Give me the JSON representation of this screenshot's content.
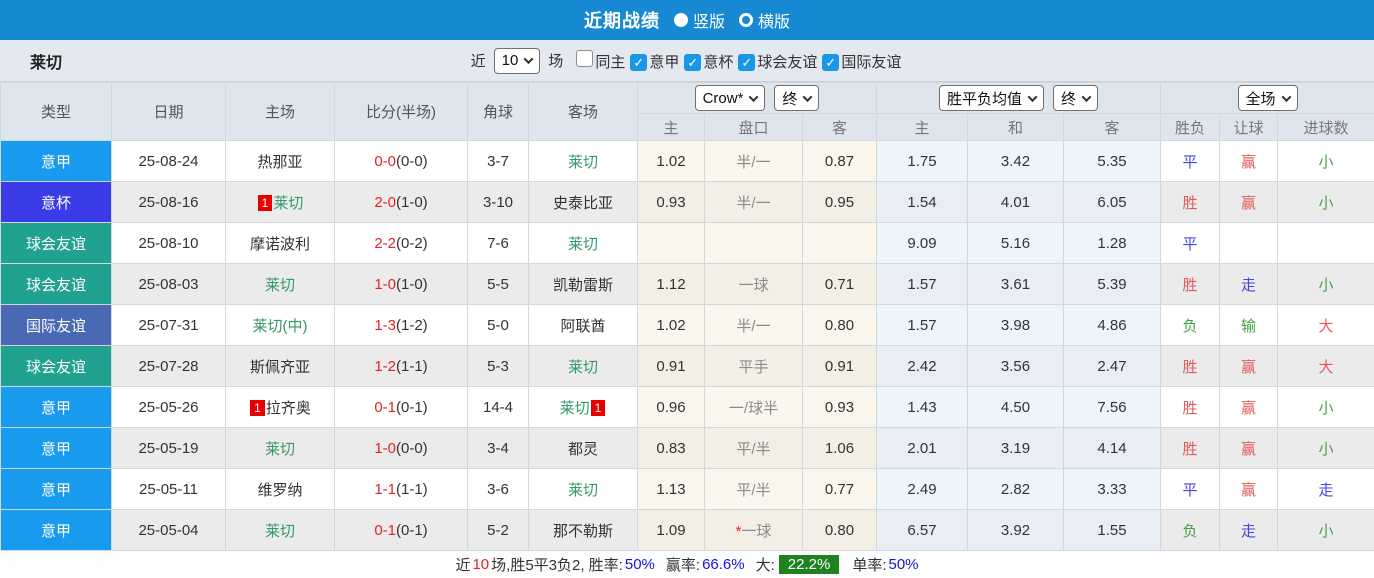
{
  "title_bar": {
    "title": "近期战绩",
    "radio_vertical": "竖版",
    "radio_horizontal": "横版"
  },
  "filter": {
    "team": "莱切",
    "near_label": "近",
    "count_value": "10",
    "games_label": "场",
    "checks": [
      {
        "label": "同主",
        "checked": false
      },
      {
        "label": "意甲",
        "checked": true
      },
      {
        "label": "意杯",
        "checked": true
      },
      {
        "label": "球会友谊",
        "checked": true
      },
      {
        "label": "国际友谊",
        "checked": true
      }
    ]
  },
  "table": {
    "headers": {
      "type": "类型",
      "date": "日期",
      "home": "主场",
      "score": "比分(半场)",
      "corner": "角球",
      "away": "客场",
      "ah_home": "主",
      "ah_line": "盘口",
      "ah_away": "客",
      "eu_home": "主",
      "eu_draw": "和",
      "eu_away": "客",
      "result": "胜负",
      "handicap_result": "让球",
      "goals": "进球数"
    },
    "dropdowns": {
      "company": "Crow*",
      "company_final": "终",
      "avg": "胜平负均值",
      "avg_final": "终",
      "scope": "全场"
    },
    "rows": [
      {
        "type": "意甲",
        "date": "25-08-24",
        "home": {
          "pre": "",
          "name": "热那亚",
          "green": false,
          "post": ""
        },
        "score": "0-0",
        "half": "(0-0)",
        "corner": "3-7",
        "away": {
          "pre": "",
          "name": "莱切",
          "green": true,
          "post": ""
        },
        "ah": {
          "home": "1.02",
          "prefix": "",
          "line": "半/一",
          "away": "0.87"
        },
        "eu": [
          "1.75",
          "3.42",
          "5.35"
        ],
        "result": {
          "t": "平",
          "c": "blue"
        },
        "handicap_result": {
          "t": "赢",
          "c": "red"
        },
        "goals": {
          "t": "小",
          "c": "green"
        }
      },
      {
        "type": "意杯",
        "date": "25-08-16",
        "home": {
          "pre": "1",
          "name": "莱切",
          "green": true,
          "post": ""
        },
        "score": "2-0",
        "half": "(1-0)",
        "corner": "3-10",
        "away": {
          "pre": "",
          "name": "史泰比亚",
          "green": false,
          "post": ""
        },
        "ah": {
          "home": "0.93",
          "prefix": "",
          "line": "半/一",
          "away": "0.95"
        },
        "eu": [
          "1.54",
          "4.01",
          "6.05"
        ],
        "result": {
          "t": "胜",
          "c": "red"
        },
        "handicap_result": {
          "t": "赢",
          "c": "red"
        },
        "goals": {
          "t": "小",
          "c": "green"
        }
      },
      {
        "type": "球会友谊",
        "date": "25-08-10",
        "home": {
          "pre": "",
          "name": "摩诺波利",
          "green": false,
          "post": ""
        },
        "score": "2-2",
        "half": "(0-2)",
        "corner": "7-6",
        "away": {
          "pre": "",
          "name": "莱切",
          "green": true,
          "post": ""
        },
        "ah": {
          "home": "",
          "prefix": "",
          "line": "",
          "away": ""
        },
        "eu": [
          "9.09",
          "5.16",
          "1.28"
        ],
        "result": {
          "t": "平",
          "c": "blue"
        },
        "handicap_result": {
          "t": "",
          "c": ""
        },
        "goals": {
          "t": "",
          "c": ""
        }
      },
      {
        "type": "球会友谊",
        "date": "25-08-03",
        "home": {
          "pre": "",
          "name": "莱切",
          "green": true,
          "post": ""
        },
        "score": "1-0",
        "half": "(1-0)",
        "corner": "5-5",
        "away": {
          "pre": "",
          "name": "凯勒雷斯",
          "green": false,
          "post": ""
        },
        "ah": {
          "home": "1.12",
          "prefix": "",
          "line": "一球",
          "away": "0.71"
        },
        "eu": [
          "1.57",
          "3.61",
          "5.39"
        ],
        "result": {
          "t": "胜",
          "c": "red"
        },
        "handicap_result": {
          "t": "走",
          "c": "blue"
        },
        "goals": {
          "t": "小",
          "c": "green"
        }
      },
      {
        "type": "国际友谊",
        "date": "25-07-31",
        "home": {
          "pre": "",
          "name": "莱切(中)",
          "green": true,
          "post": ""
        },
        "score": "1-3",
        "half": "(1-2)",
        "corner": "5-0",
        "away": {
          "pre": "",
          "name": "阿联酋",
          "green": false,
          "post": ""
        },
        "ah": {
          "home": "1.02",
          "prefix": "",
          "line": "半/一",
          "away": "0.80"
        },
        "eu": [
          "1.57",
          "3.98",
          "4.86"
        ],
        "result": {
          "t": "负",
          "c": "green"
        },
        "handicap_result": {
          "t": "输",
          "c": "green"
        },
        "goals": {
          "t": "大",
          "c": "red"
        }
      },
      {
        "type": "球会友谊",
        "date": "25-07-28",
        "home": {
          "pre": "",
          "name": "斯佩齐亚",
          "green": false,
          "post": ""
        },
        "score": "1-2",
        "half": "(1-1)",
        "corner": "5-3",
        "away": {
          "pre": "",
          "name": "莱切",
          "green": true,
          "post": ""
        },
        "ah": {
          "home": "0.91",
          "prefix": "",
          "line": "平手",
          "away": "0.91"
        },
        "eu": [
          "2.42",
          "3.56",
          "2.47"
        ],
        "result": {
          "t": "胜",
          "c": "red"
        },
        "handicap_result": {
          "t": "赢",
          "c": "red"
        },
        "goals": {
          "t": "大",
          "c": "red"
        }
      },
      {
        "type": "意甲",
        "date": "25-05-26",
        "home": {
          "pre": "1",
          "name": "拉齐奥",
          "green": false,
          "post": ""
        },
        "score": "0-1",
        "half": "(0-1)",
        "corner": "14-4",
        "away": {
          "pre": "",
          "name": "莱切",
          "green": true,
          "post": "1"
        },
        "ah": {
          "home": "0.96",
          "prefix": "",
          "line": "一/球半",
          "away": "0.93"
        },
        "eu": [
          "1.43",
          "4.50",
          "7.56"
        ],
        "result": {
          "t": "胜",
          "c": "red"
        },
        "handicap_result": {
          "t": "赢",
          "c": "red"
        },
        "goals": {
          "t": "小",
          "c": "green"
        }
      },
      {
        "type": "意甲",
        "date": "25-05-19",
        "home": {
          "pre": "",
          "name": "莱切",
          "green": true,
          "post": ""
        },
        "score": "1-0",
        "half": "(0-0)",
        "corner": "3-4",
        "away": {
          "pre": "",
          "name": "都灵",
          "green": false,
          "post": ""
        },
        "ah": {
          "home": "0.83",
          "prefix": "",
          "line": "平/半",
          "away": "1.06"
        },
        "eu": [
          "2.01",
          "3.19",
          "4.14"
        ],
        "result": {
          "t": "胜",
          "c": "red"
        },
        "handicap_result": {
          "t": "赢",
          "c": "red"
        },
        "goals": {
          "t": "小",
          "c": "green"
        }
      },
      {
        "type": "意甲",
        "date": "25-05-11",
        "home": {
          "pre": "",
          "name": "维罗纳",
          "green": false,
          "post": ""
        },
        "score": "1-1",
        "half": "(1-1)",
        "corner": "3-6",
        "away": {
          "pre": "",
          "name": "莱切",
          "green": true,
          "post": ""
        },
        "ah": {
          "home": "1.13",
          "prefix": "",
          "line": "平/半",
          "away": "0.77"
        },
        "eu": [
          "2.49",
          "2.82",
          "3.33"
        ],
        "result": {
          "t": "平",
          "c": "blue"
        },
        "handicap_result": {
          "t": "赢",
          "c": "red"
        },
        "goals": {
          "t": "走",
          "c": "blue"
        }
      },
      {
        "type": "意甲",
        "date": "25-05-04",
        "home": {
          "pre": "",
          "name": "莱切",
          "green": true,
          "post": ""
        },
        "score": "0-1",
        "half": "(0-1)",
        "corner": "5-2",
        "away": {
          "pre": "",
          "name": "那不勒斯",
          "green": false,
          "post": ""
        },
        "ah": {
          "home": "1.09",
          "prefix": "*",
          "line": "一球",
          "away": "0.80"
        },
        "eu": [
          "6.57",
          "3.92",
          "1.55"
        ],
        "result": {
          "t": "负",
          "c": "green"
        },
        "handicap_result": {
          "t": "走",
          "c": "blue"
        },
        "goals": {
          "t": "小",
          "c": "green"
        }
      }
    ]
  },
  "summary": {
    "near_label": "近",
    "count": "10",
    "record": "场,胜5平3负2, 胜率:",
    "win_rate": "50%",
    "handicap_label": "赢率:",
    "handicap_rate": "66.6%",
    "big_label": "大:",
    "big_rate": "22.2%",
    "single_label": "单率:",
    "single_rate": "50%"
  },
  "palette": {
    "topbar_blue": "#1689d2",
    "type_colors": {
      "意甲": "#189aee",
      "意杯": "#3a3ae6",
      "球会友谊": "#21a18f",
      "国际友谊": "#4a69b4"
    },
    "team_highlight_green": "#339966",
    "score_red": "#e62222",
    "result_red": "#e4595c",
    "result_blue": "#4646e0",
    "result_green": "#4aa04a",
    "summary_rate_blue": "#1414dd",
    "summary_big_green": "#1e821e"
  }
}
